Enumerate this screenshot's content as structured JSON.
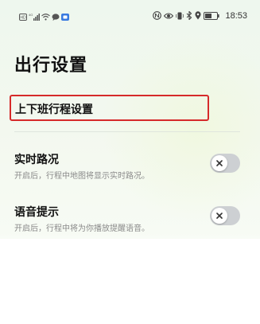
{
  "status_bar": {
    "time": "18:53",
    "left_icons": [
      "hd-icon",
      "signal-4g-icon",
      "wifi-icon",
      "chat-bubble-icon",
      "app-notification-icon"
    ],
    "right_icons": [
      "nfc-icon",
      "eye-comfort-icon",
      "vibrate-icon",
      "bluetooth-icon",
      "location-icon",
      "battery-icon"
    ],
    "battery": "56"
  },
  "page": {
    "title": "出行设置"
  },
  "commute": {
    "label": "上下班行程设置"
  },
  "settings": [
    {
      "title": "实时路况",
      "description": "开启后，行程中地图将显示实时路况。",
      "enabled": false
    },
    {
      "title": "语音提示",
      "description": "开启后，行程中将为你播放提醒语音。",
      "enabled": false
    }
  ],
  "colors": {
    "highlight_border": "#d62a2a",
    "toggle_off_track": "#cdd0d3",
    "background_tint": "#eef7ee"
  }
}
